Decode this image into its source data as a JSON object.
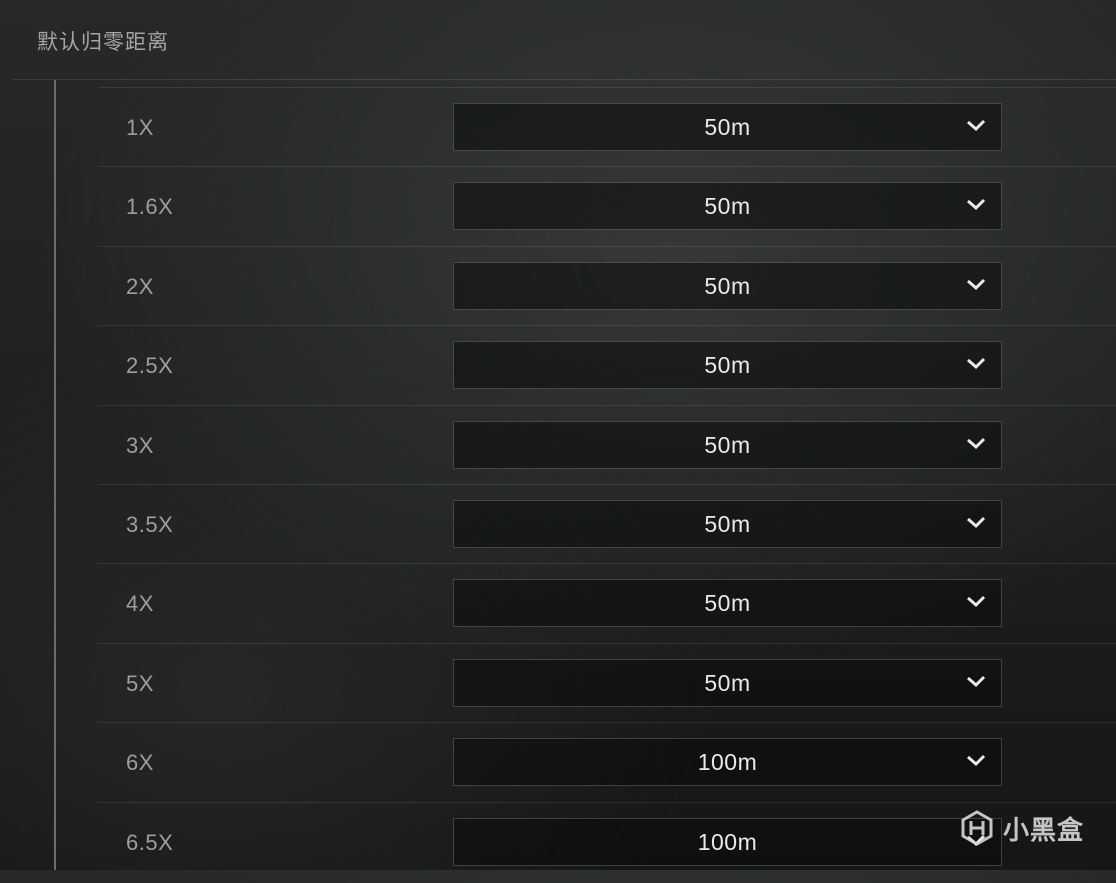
{
  "section": {
    "title": "默认归零距离"
  },
  "rows": [
    {
      "label": "1X",
      "value": "50m"
    },
    {
      "label": "1.6X",
      "value": "50m"
    },
    {
      "label": "2X",
      "value": "50m"
    },
    {
      "label": "2.5X",
      "value": "50m"
    },
    {
      "label": "3X",
      "value": "50m"
    },
    {
      "label": "3.5X",
      "value": "50m"
    },
    {
      "label": "4X",
      "value": "50m"
    },
    {
      "label": "5X",
      "value": "50m"
    },
    {
      "label": "6X",
      "value": "100m"
    },
    {
      "label": "6.5X",
      "value": "100m"
    }
  ],
  "icons": {
    "dropdown": "chevron-down-icon",
    "watermark": "xiaoheihe-logo"
  },
  "watermark": {
    "text": "小黑盒"
  },
  "colors": {
    "background": "#1e2021",
    "label": "#9c9e9f",
    "value": "#e9eaea",
    "dropdown_border": "#4a4c4d"
  }
}
